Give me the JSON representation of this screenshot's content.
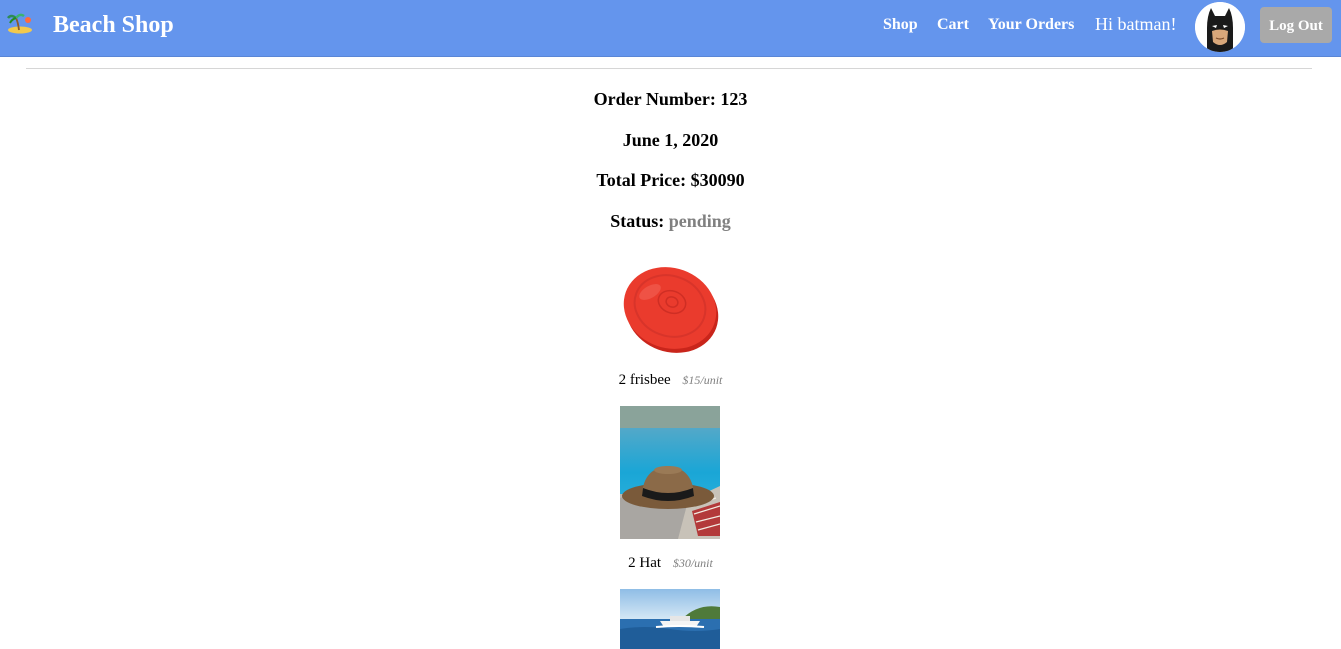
{
  "header": {
    "brand": "Beach Shop",
    "nav": [
      "Shop",
      "Cart",
      "Your Orders"
    ],
    "greeting": "Hi batman!",
    "logout_label": "Log Out"
  },
  "order": {
    "number_label": "Order Number:",
    "number": "123",
    "date": "June 1, 2020",
    "total_label": "Total Price:",
    "total": "$30090",
    "status_label": "Status:",
    "status": "pending"
  },
  "items": [
    {
      "quantity": "2",
      "name": "frisbee",
      "unit_price": "$15/unit",
      "image": "frisbee-image"
    },
    {
      "quantity": "2",
      "name": "Hat",
      "unit_price": "$30/unit",
      "image": "hat-image"
    },
    {
      "image": "boat-image"
    }
  ],
  "colors": {
    "navbar": "#6495ed",
    "logout_button": "#a9a9a9",
    "status": "#808080"
  }
}
